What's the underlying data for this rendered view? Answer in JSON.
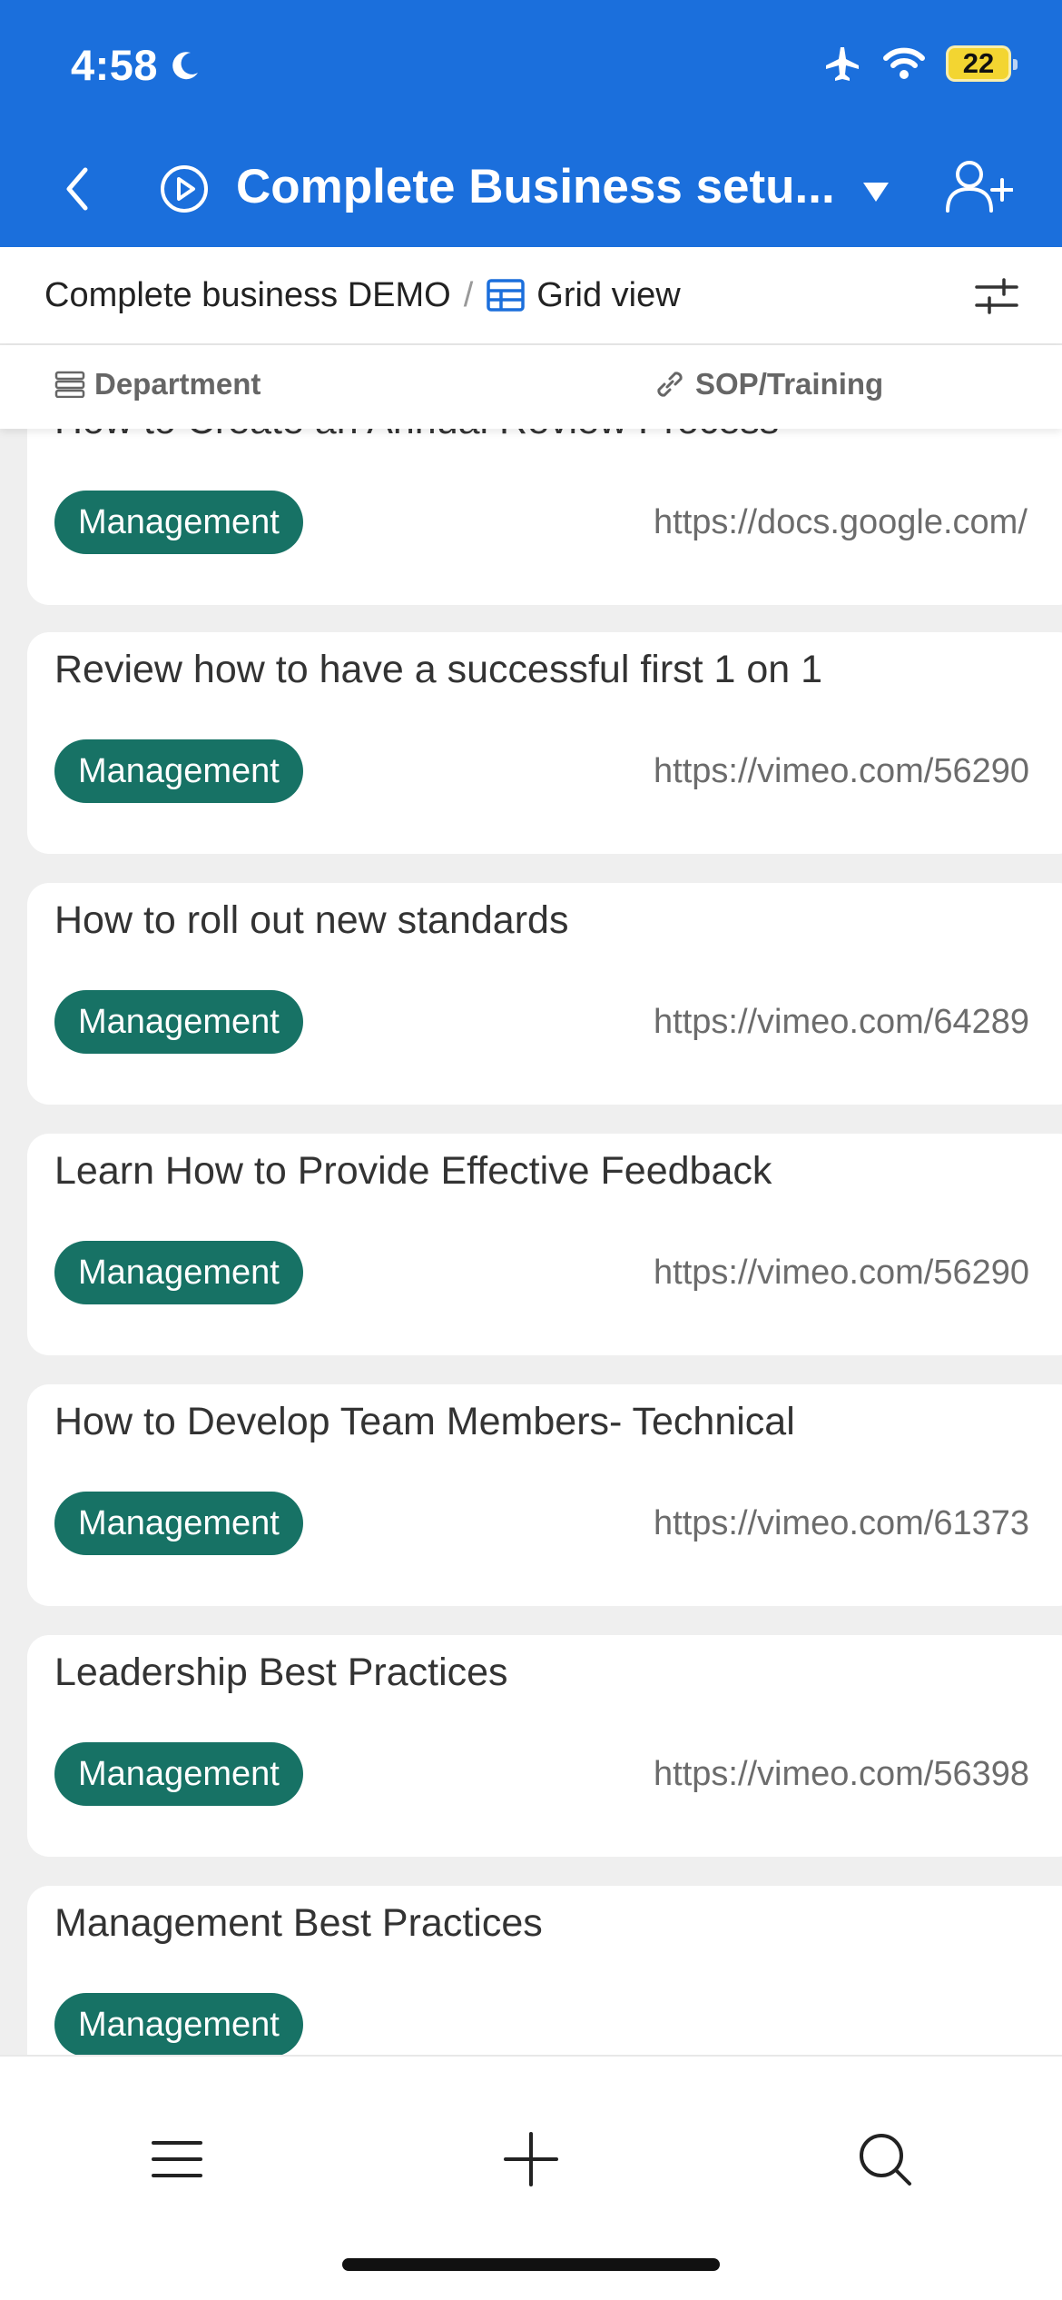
{
  "status_bar": {
    "time": "4:58",
    "battery": "22"
  },
  "nav": {
    "title": "Complete Business setu..."
  },
  "view_bar": {
    "base_name": "Complete business DEMO",
    "separator": "/",
    "view_name": "Grid view"
  },
  "columns": {
    "department": "Department",
    "sop": "SOP/Training"
  },
  "records": [
    {
      "title": "How to Create an Annual Review Process",
      "department": "Management",
      "link": "https://docs.google.com/"
    },
    {
      "title": "Review how to have a successful first 1 on 1",
      "department": "Management",
      "link": "https://vimeo.com/56290"
    },
    {
      "title": "How to roll out new standards",
      "department": "Management",
      "link": "https://vimeo.com/64289"
    },
    {
      "title": "Learn How to Provide Effective Feedback",
      "department": "Management",
      "link": "https://vimeo.com/56290"
    },
    {
      "title": "How to Develop Team Members- Technical",
      "department": "Management",
      "link": "https://vimeo.com/61373"
    },
    {
      "title": "Leadership Best Practices",
      "department": "Management",
      "link": "https://vimeo.com/56398"
    },
    {
      "title": "Management Best Practices",
      "department": "Management",
      "link": ""
    }
  ],
  "colors": {
    "header_blue": "#1b6fdc",
    "tag_green": "#177265",
    "battery_yellow": "#f3d531"
  },
  "icons": {
    "status": [
      "moon-icon",
      "airplane-icon",
      "wifi-icon",
      "battery-icon"
    ],
    "nav": [
      "back-chevron-icon",
      "play-circle-icon",
      "caret-down-icon",
      "add-user-icon"
    ],
    "toolbar": [
      "menu-icon",
      "plus-icon",
      "search-icon"
    ]
  }
}
